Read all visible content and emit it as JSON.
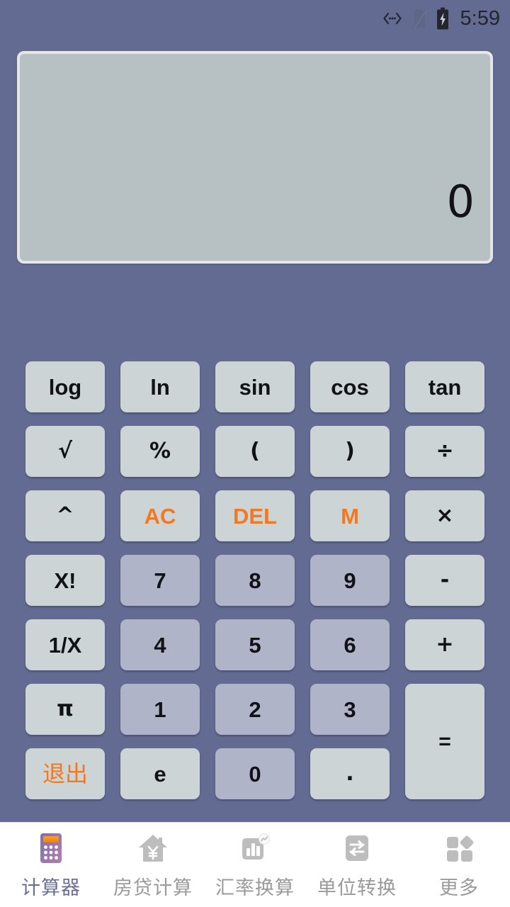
{
  "status_bar": {
    "time": "5:59",
    "icons": [
      {
        "name": "usb-debug-icon",
        "glyph": "‹···›"
      },
      {
        "name": "sim-card-off-icon",
        "glyph": "sim-slash"
      },
      {
        "name": "battery-charging-icon",
        "glyph": "battery-bolt"
      }
    ]
  },
  "display": {
    "value": "0"
  },
  "keypad": {
    "keys": [
      {
        "label": "log",
        "name": "key-log",
        "kind": "func"
      },
      {
        "label": "ln",
        "name": "key-ln",
        "kind": "func"
      },
      {
        "label": "sin",
        "name": "key-sin",
        "kind": "func"
      },
      {
        "label": "cos",
        "name": "key-cos",
        "kind": "func"
      },
      {
        "label": "tan",
        "name": "key-tan",
        "kind": "func"
      },
      {
        "label": "√",
        "name": "key-sqrt",
        "kind": "func"
      },
      {
        "label": "%",
        "name": "key-percent",
        "kind": "func"
      },
      {
        "label": "(",
        "name": "key-paren-open",
        "kind": "func"
      },
      {
        "label": ")",
        "name": "key-paren-close",
        "kind": "func"
      },
      {
        "label": "÷",
        "name": "key-divide",
        "kind": "func"
      },
      {
        "label": "^",
        "name": "key-power",
        "kind": "func"
      },
      {
        "label": "AC",
        "name": "key-all-clear",
        "kind": "accent"
      },
      {
        "label": "DEL",
        "name": "key-delete",
        "kind": "accent"
      },
      {
        "label": "M",
        "name": "key-memory",
        "kind": "accent"
      },
      {
        "label": "×",
        "name": "key-multiply",
        "kind": "func"
      },
      {
        "label": "X!",
        "name": "key-factorial",
        "kind": "func"
      },
      {
        "label": "7",
        "name": "key-7",
        "kind": "digit"
      },
      {
        "label": "8",
        "name": "key-8",
        "kind": "digit"
      },
      {
        "label": "9",
        "name": "key-9",
        "kind": "digit"
      },
      {
        "label": "-",
        "name": "key-minus",
        "kind": "func"
      },
      {
        "label": "1/X",
        "name": "key-reciprocal",
        "kind": "func"
      },
      {
        "label": "4",
        "name": "key-4",
        "kind": "digit"
      },
      {
        "label": "5",
        "name": "key-5",
        "kind": "digit"
      },
      {
        "label": "6",
        "name": "key-6",
        "kind": "digit"
      },
      {
        "label": "+",
        "name": "key-plus",
        "kind": "func"
      },
      {
        "label": "π",
        "name": "key-pi",
        "kind": "func"
      },
      {
        "label": "1",
        "name": "key-1",
        "kind": "digit"
      },
      {
        "label": "2",
        "name": "key-2",
        "kind": "digit"
      },
      {
        "label": "3",
        "name": "key-3",
        "kind": "digit"
      },
      {
        "label": "=",
        "name": "key-equals",
        "kind": "equals"
      },
      {
        "label": "退出",
        "name": "key-exit",
        "kind": "accent-cjk"
      },
      {
        "label": "e",
        "name": "key-e",
        "kind": "func"
      },
      {
        "label": "0",
        "name": "key-0",
        "kind": "digit"
      },
      {
        "label": ".",
        "name": "key-decimal",
        "kind": "func"
      }
    ]
  },
  "bottom_nav": {
    "items": [
      {
        "label": "计算器",
        "name": "nav-item-calculator",
        "icon": "calculator-icon",
        "active": true
      },
      {
        "label": "房贷计算",
        "name": "nav-item-mortgage",
        "icon": "house-yen-icon",
        "active": false
      },
      {
        "label": "汇率换算",
        "name": "nav-item-exchange-rate",
        "icon": "bar-chart-icon",
        "active": false
      },
      {
        "label": "单位转换",
        "name": "nav-item-unit-convert",
        "icon": "swap-arrows-icon",
        "active": false
      },
      {
        "label": "更多",
        "name": "nav-item-more",
        "icon": "grid-more-icon",
        "active": false
      }
    ]
  },
  "colors": {
    "background": "#636b92",
    "display_bg": "#b7c0c3",
    "display_border": "#e6e6e6",
    "key_func": "#ccd4d5",
    "key_digit": "#b0b4c9",
    "accent_orange": "#f4781f",
    "nav_bg": "#ffffff",
    "nav_active": "#6b6f96",
    "nav_inactive": "#9a9a9a"
  }
}
